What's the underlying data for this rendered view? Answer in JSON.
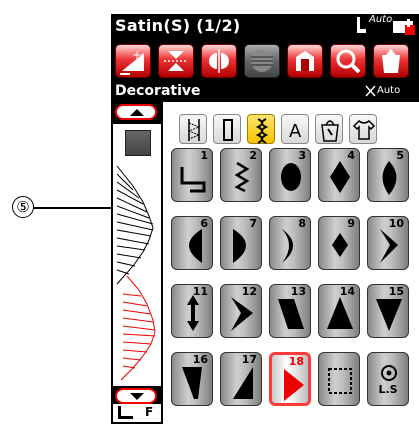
{
  "callout": {
    "number": "⑤"
  },
  "header": {
    "title": "Satin(S) (1/2)",
    "foot_auto": "Auto"
  },
  "toolbar": {
    "buttons": [
      "add-stitch",
      "mirror-vertical",
      "mirror-horizontal",
      "elongation",
      "memory",
      "zoom",
      "save"
    ]
  },
  "subbar": {
    "category": "Decorative",
    "needle_auto": "Auto"
  },
  "categories": [
    "stitch-type-1",
    "stitch-type-2",
    "satin",
    "alphabet",
    "bag",
    "shirt"
  ],
  "selected_category": "satin",
  "foot_label": "F",
  "stitches": [
    {
      "n": "1",
      "shape": "step"
    },
    {
      "n": "2",
      "shape": "zigzag-s"
    },
    {
      "n": "3",
      "shape": "oval"
    },
    {
      "n": "4",
      "shape": "diamond"
    },
    {
      "n": "5",
      "shape": "leaf"
    },
    {
      "n": "6",
      "shape": "half-oval"
    },
    {
      "n": "7",
      "shape": "d-shape"
    },
    {
      "n": "8",
      "shape": "crescent"
    },
    {
      "n": "9",
      "shape": "diamond-small"
    },
    {
      "n": "10",
      "shape": "arrow-right"
    },
    {
      "n": "11",
      "shape": "arrow-updown"
    },
    {
      "n": "12",
      "shape": "chevron"
    },
    {
      "n": "13",
      "shape": "parallelogram"
    },
    {
      "n": "14",
      "shape": "triangle-up"
    },
    {
      "n": "15",
      "shape": "triangle-down"
    },
    {
      "n": "16",
      "shape": "wedge-left"
    },
    {
      "n": "17",
      "shape": "wedge-right"
    },
    {
      "n": "18",
      "shape": "triangle-right"
    },
    {
      "n": "",
      "shape": "dotted-square"
    },
    {
      "n": "",
      "shape": "ls",
      "label": "L.S"
    }
  ],
  "selected_stitch": "18"
}
